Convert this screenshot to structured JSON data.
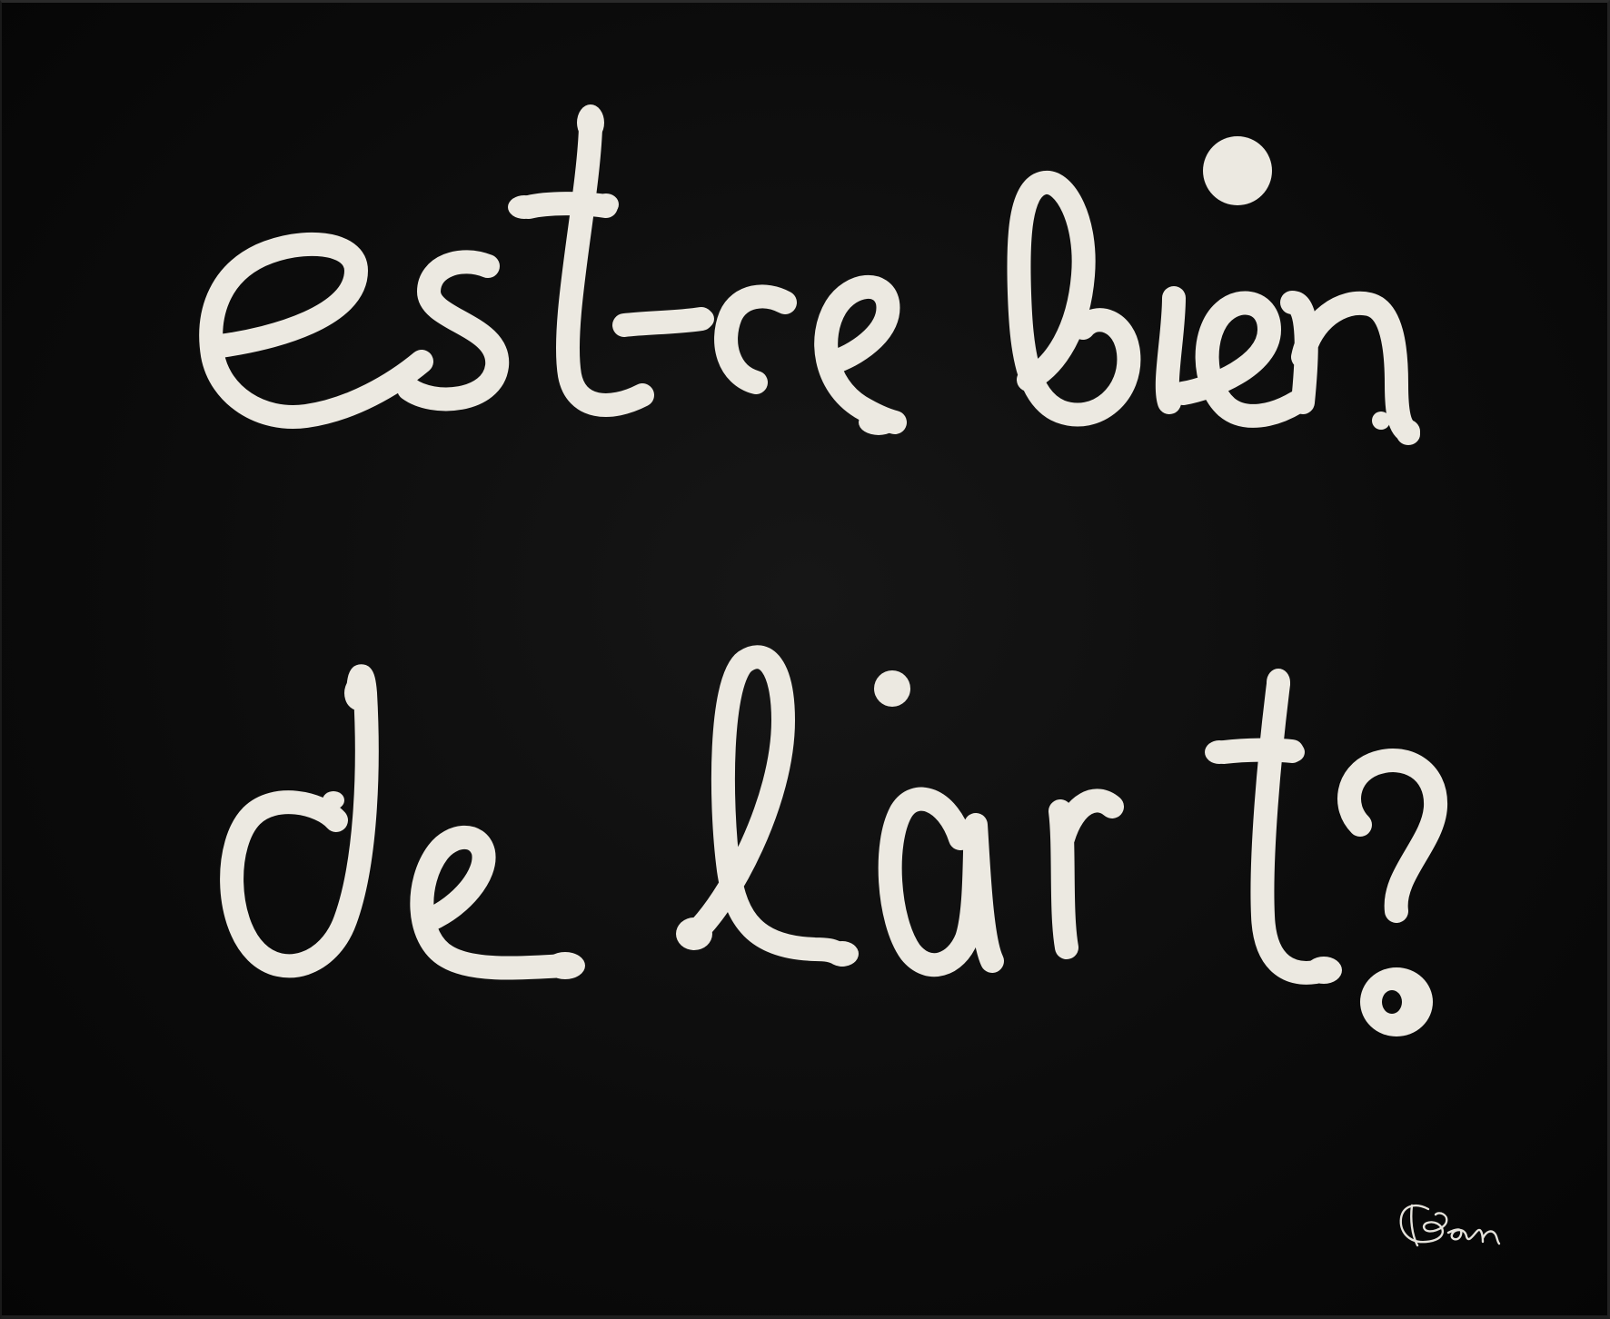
{
  "artwork": {
    "line_1": "est-ce bien",
    "line_2": "de l'art?",
    "signature": "Ben",
    "background_color": "#0b0b0b",
    "paint_color": "#ece9e1"
  }
}
